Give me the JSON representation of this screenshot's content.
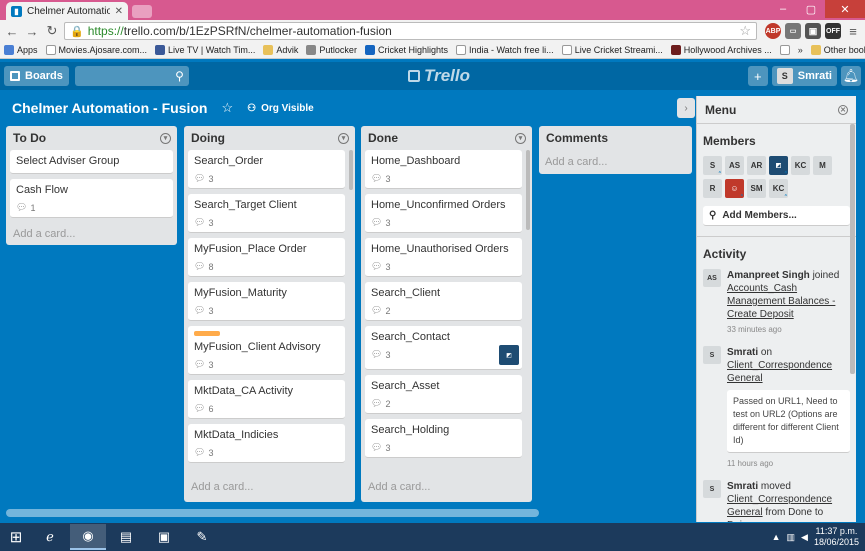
{
  "browser": {
    "tab_title": "Chelmer Automation - Fu",
    "url_scheme": "https://",
    "url_rest": "trello.com/b/1EzPSRfN/chelmer-automation-fusion",
    "bookmarks": [
      "Apps",
      "Movies.Ajosare.com...",
      "Live TV | Watch Tim...",
      "Advik",
      "Putlocker",
      "Cricket Highlights",
      "India - Watch free li...",
      "Live Cricket Streami...",
      "Hollywood Archives ..."
    ],
    "more_bookmarks": "»",
    "other_bookmarks": "Other bookmarks",
    "ext_badge": "ABP",
    "ext_off": "OFF"
  },
  "header": {
    "boards_label": "Boards",
    "logo_text": "Trello",
    "user_initial": "S",
    "user_name": "Smrati"
  },
  "board": {
    "title": "Chelmer Automation - Fusion",
    "visibility": "Org Visible"
  },
  "lists": {
    "todo": {
      "name": "To Do",
      "cards": [
        {
          "title": "Select Adviser Group"
        },
        {
          "title": "Cash Flow",
          "comments": "1"
        }
      ],
      "add": "Add a card..."
    },
    "doing": {
      "name": "Doing",
      "cards": [
        {
          "title": "Search_Order",
          "comments": "3"
        },
        {
          "title": "Search_Target Client",
          "comments": "3"
        },
        {
          "title": "MyFusion_Place Order",
          "comments": "8"
        },
        {
          "title": "MyFusion_Maturity",
          "comments": "3"
        },
        {
          "title": "MyFusion_Client Advisory",
          "comments": "3"
        },
        {
          "title": "MktData_CA Activity",
          "comments": "6"
        },
        {
          "title": "MktData_Indicies",
          "comments": "3"
        }
      ],
      "add": "Add a card..."
    },
    "done": {
      "name": "Done",
      "cards": [
        {
          "title": "Home_Dashboard",
          "comments": "3"
        },
        {
          "title": "Home_Unconfirmed Orders",
          "comments": "3"
        },
        {
          "title": "Home_Unauthorised Orders",
          "comments": "3"
        },
        {
          "title": "Search_Client",
          "comments": "2"
        },
        {
          "title": "Search_Contact",
          "comments": "3"
        },
        {
          "title": "Search_Asset",
          "comments": "2"
        },
        {
          "title": "Search_Holding",
          "comments": "3"
        }
      ],
      "add": "Add a card..."
    },
    "comments": {
      "name": "Comments",
      "add": "Add a card..."
    }
  },
  "sidebar": {
    "menu_title": "Menu",
    "members_title": "Members",
    "members": [
      "S",
      "AS",
      "AR",
      "",
      "KC",
      "M",
      "R",
      "",
      "SM",
      "KC"
    ],
    "add_members": "Add Members...",
    "activity_title": "Activity",
    "activity": [
      {
        "avatar": "AS",
        "user": "Amanpreet Singh",
        "verb": "joined",
        "link": "Accounts_Cash Management Balances - Create Deposit",
        "time": "33 minutes ago"
      },
      {
        "avatar": "S",
        "user": "Smrati",
        "verb": "on",
        "link": "Client_Correspondence General",
        "comment": "Passed on URL1, Need to test on URL2 (Options are different for different Client Id)",
        "time": "11 hours ago"
      },
      {
        "avatar": "S",
        "user": "Smrati",
        "verb": "moved",
        "link": "Client_Correspondence General",
        "tail": "from Done to Doing"
      }
    ]
  },
  "taskbar": {
    "time": "11:37 p.m.",
    "date": "18/06/2015"
  },
  "colors": {
    "board_bg": "#0079bf",
    "header_bg": "#0067a3",
    "list_bg": "#e2e4e6",
    "label_orange": "#ffab4a"
  }
}
